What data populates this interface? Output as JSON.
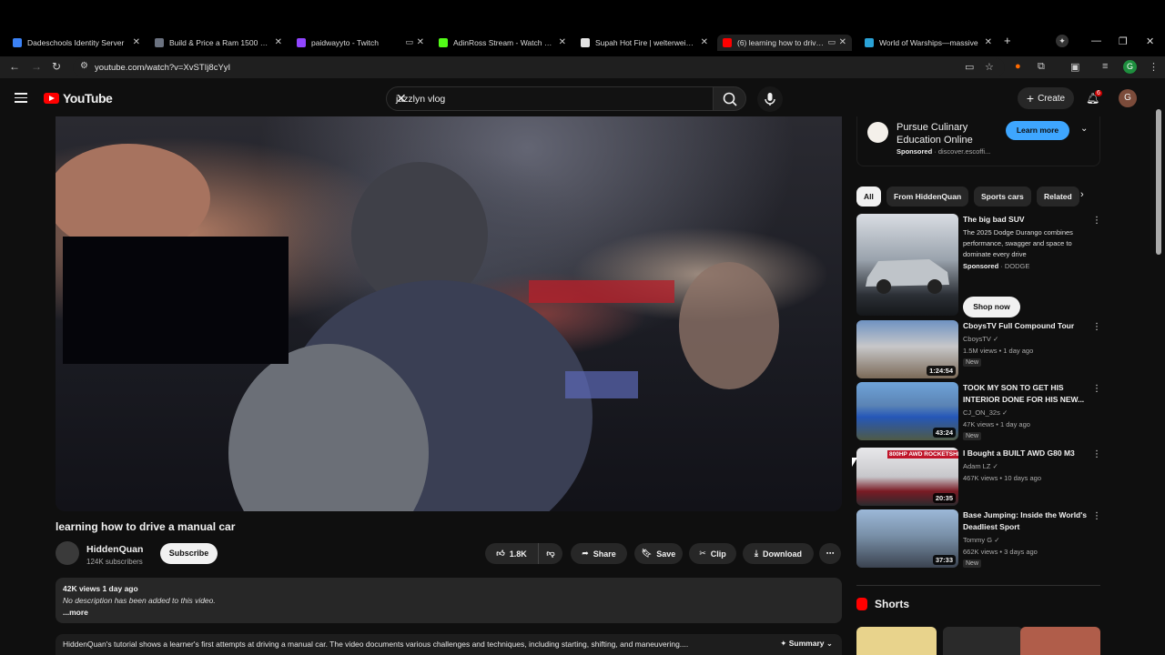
{
  "browser": {
    "tabs": [
      {
        "label": "Dadeschools Identity Server",
        "color": "#3b82f6"
      },
      {
        "label": "Build & Price a Ram 1500 | Ram",
        "color": "#6b7280"
      },
      {
        "label": "paidwayyto - Twitch",
        "color": "#9146ff"
      },
      {
        "label": "AdinRoss Stream - Watch Live",
        "color": "#53fc18"
      },
      {
        "label": "Supah Hot Fire | welterweight",
        "color": "#e5e5e5"
      },
      {
        "label": "(6) learning how to drive a",
        "color": "#ff0000"
      },
      {
        "label": "World of Warships—massive",
        "color": "#2aa2d6"
      }
    ],
    "url": "youtube.com/watch?v=XvSTIj8cYyI",
    "profile_initial": "G"
  },
  "youtube": {
    "logo_text": "YouTube",
    "search_value": "jazzlyn vlog",
    "create_label": "Create",
    "notif_count": "6",
    "user_initial": "G"
  },
  "video": {
    "title": "learning how to drive a manual car",
    "channel": "HiddenQuan",
    "subscribers": "124K subscribers",
    "subscribe_label": "Subscribe",
    "likes": "1.8K",
    "share_label": "Share",
    "save_label": "Save",
    "clip_label": "Clip",
    "download_label": "Download",
    "views_date": "42K views  1 day ago",
    "no_description": "No description has been added to this video.",
    "more_label": "...more",
    "summary_text": "HiddenQuan's tutorial shows a learner's first attempts at driving a manual car. The video documents various challenges and techniques, including starting, shifting, and maneuvering....",
    "summary_label": "Summary"
  },
  "ad": {
    "title": "Pursue Culinary Education Online",
    "sponsored": "Sponsored",
    "domain": "discover.escoffi...",
    "button": "Learn more"
  },
  "chips": [
    "All",
    "From HiddenQuan",
    "Sports cars",
    "Related"
  ],
  "recommendations": [
    {
      "title": "The big bad SUV",
      "subtitle": "The 2025 Dodge Durango combines performance, swagger and space to dominate every drive",
      "sponsored": "Sponsored",
      "advertiser": "DODGE",
      "button": "Shop now"
    },
    {
      "title": "CboysTV Full Compound Tour",
      "channel": "CboysTV",
      "meta": "1.5M views • 1 day ago",
      "badge": "New",
      "duration": "1:24:54"
    },
    {
      "title": "TOOK MY SON TO GET HIS INTERIOR DONE FOR HIS NEW...",
      "channel": "CJ_ON_32s",
      "meta": "47K views • 1 day ago",
      "badge": "New",
      "duration": "43:24"
    },
    {
      "title": "I Bought a BUILT AWD G80 M3",
      "channel": "Adam LZ",
      "meta": "467K views • 10 days ago",
      "duration": "20:35",
      "thumb_text": "800HP AWD ROCKETSHIP!"
    },
    {
      "title": "Base Jumping: Inside the World's Deadliest Sport",
      "channel": "Tommy G",
      "meta": "662K views • 3 days ago",
      "badge": "New",
      "duration": "37:33"
    }
  ],
  "shorts": {
    "label": "Shorts"
  },
  "colors": {
    "accent": "#ff0000",
    "link_blue": "#3ea6ff",
    "background": "#0f0f0f"
  }
}
